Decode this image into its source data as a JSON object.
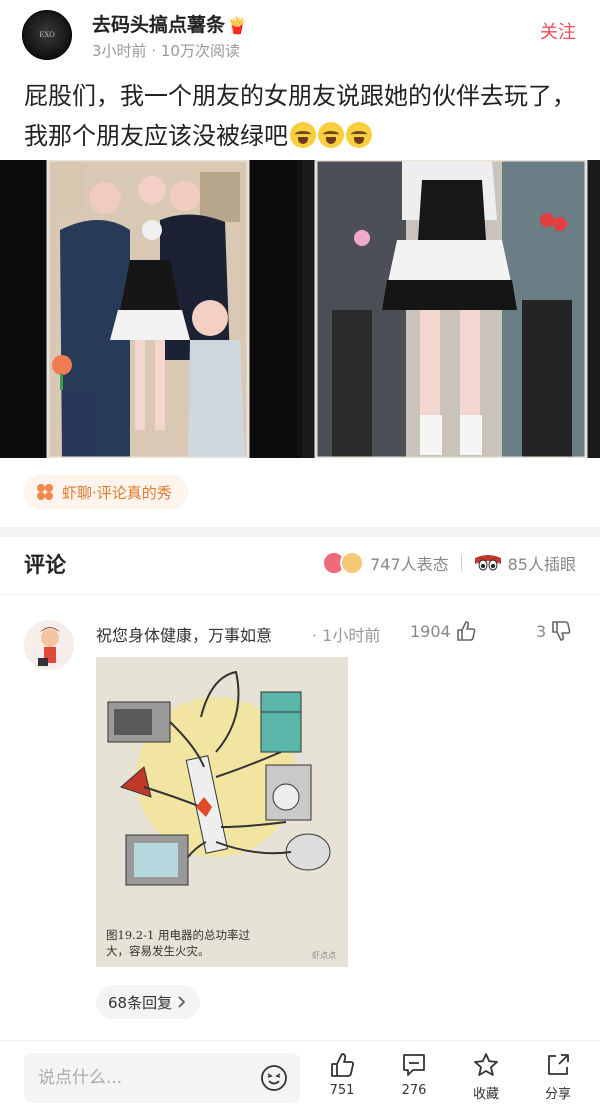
{
  "post": {
    "author": "去码头搞点薯条",
    "author_emoji": "🍟",
    "time": "3小时前",
    "reads": "10万次阅读",
    "follow_label": "关注",
    "title_text": "屁股们，我一个朋友的女朋友说跟她的伙伴去玩了，我那个朋友应该没被绿吧",
    "avatar_text": "EXO"
  },
  "tag": {
    "label": "虾聊·评论真的秀"
  },
  "comments_header": {
    "title": "评论",
    "reactions": "747人表态",
    "insert": "85人插眼"
  },
  "comment": {
    "text": "祝您身体健康，万事如意",
    "time": "· 1小时前",
    "likes": "1904",
    "dislikes": "3",
    "image_caption_1": "图19.2-1  用电器的总功率过",
    "image_caption_2": "大，容易发生火灾。",
    "image_watermark": "虾点点",
    "replies": "68条回复"
  },
  "bottom_bar": {
    "input_placeholder": "说点什么...",
    "like_count": "751",
    "comment_count": "276",
    "favorite_label": "收藏",
    "share_label": "分享"
  },
  "colors": {
    "accent": "#f04d5a",
    "tag_text": "#e07a2a",
    "muted": "#999999"
  }
}
